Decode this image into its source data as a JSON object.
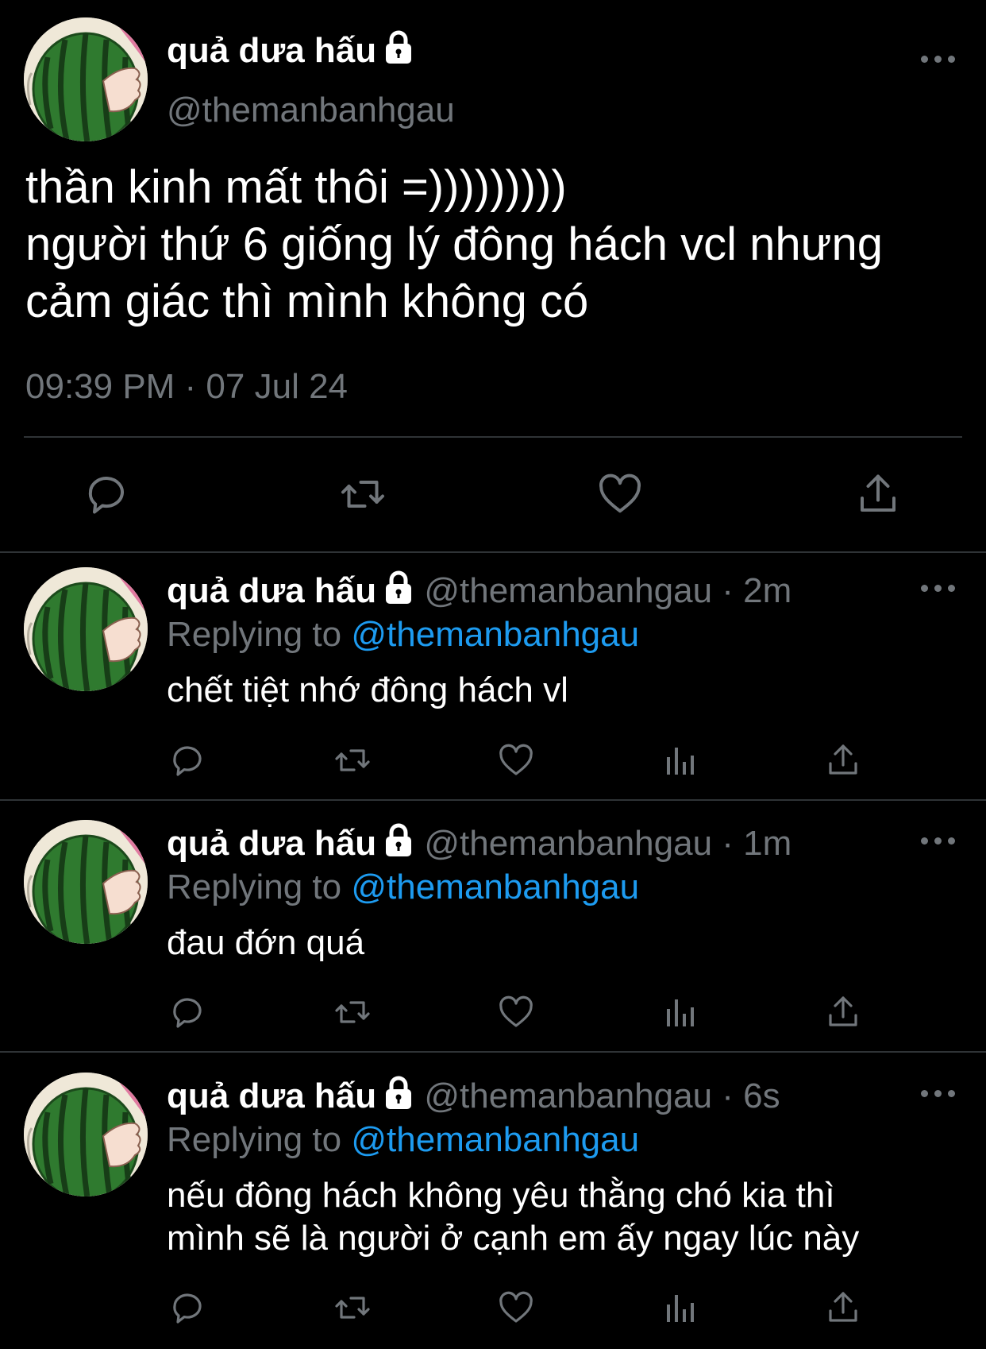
{
  "main_tweet": {
    "display_name": "quả dưa hấu",
    "handle": "@themanbanhgau",
    "text": "thần kinh mất thôi =)))))))))\nngười thứ 6 giống lý đông hách vcl nhưng cảm giác thì mình không có",
    "timestamp": "09:39 PM · 07 Jul 24"
  },
  "replies": [
    {
      "display_name": "quả dưa hấu",
      "handle_time": "@themanbanhgau · 2m",
      "replying_prefix": "Replying to ",
      "replying_handle": "@themanbanhgau",
      "text": "chết tiệt nhớ đông hách vl"
    },
    {
      "display_name": "quả dưa hấu",
      "handle_time": "@themanbanhgau · 1m",
      "replying_prefix": "Replying to ",
      "replying_handle": "@themanbanhgau",
      "text": "đau đớn quá"
    },
    {
      "display_name": "quả dưa hấu",
      "handle_time": "@themanbanhgau · 6s",
      "replying_prefix": "Replying to ",
      "replying_handle": "@themanbanhgau",
      "text": "nếu đông hách không yêu thằng chó kia thì\nmình sẽ là người ở cạnh em ấy ngay lúc này"
    }
  ],
  "colors": {
    "background": "#000000",
    "text": "#ffffff",
    "muted": "#71767b",
    "link": "#1d9bf0",
    "divider": "#2f3336"
  },
  "icons": [
    "lock-icon",
    "more-icon",
    "reply-icon",
    "retweet-icon",
    "like-icon",
    "views-icon",
    "share-icon"
  ]
}
